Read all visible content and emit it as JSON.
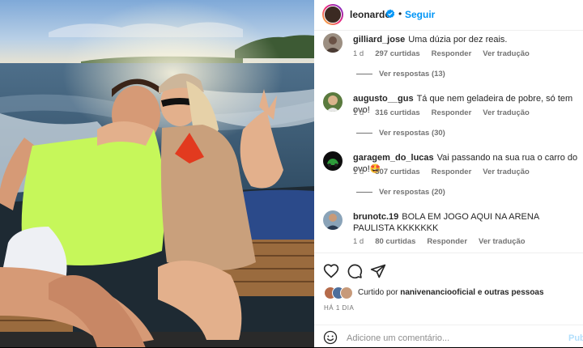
{
  "header": {
    "username": "leonardo",
    "follow_label": "Seguir",
    "dot": "•"
  },
  "comments": [
    {
      "username": "gilliard_jose",
      "text": "Uma dúzia por dez reais.",
      "time": "1 d",
      "likes": "297 curtidas",
      "reply_label": "Responder",
      "translate_label": "Ver tradução",
      "replies": "Ver respostas (13)"
    },
    {
      "username": "augusto__gus",
      "text": "Tá que nem geladeira de pobre, só tem ovo!",
      "time": "1 d",
      "likes": "316 curtidas",
      "reply_label": "Responder",
      "translate_label": "Ver tradução",
      "replies": "Ver respostas (30)"
    },
    {
      "username": "garagem_do_lucas",
      "text": "Vai passando na sua rua o carro do ovo!🤩",
      "time": "1 d",
      "likes": "307 curtidas",
      "reply_label": "Responder",
      "translate_label": "Ver tradução",
      "replies": "Ver respostas (20)"
    },
    {
      "username": "brunotc.19",
      "text": "BOLA EM JOGO AQUI NA ARENA PAULISTA KKKKKKK",
      "time": "1 d",
      "likes": "80 curtidas",
      "reply_label": "Responder",
      "translate_label": "Ver tradução"
    }
  ],
  "likes_line": {
    "prefix": "Curtido por",
    "user": "nanivenanciooficial",
    "suffix": "e outras pessoas"
  },
  "post_time": "HÁ 1 DIA",
  "add_comment": {
    "placeholder": "Adicione um comentário...",
    "publish_label": "Publicar"
  },
  "icons": {
    "like": "heart-icon",
    "comment": "comment-icon",
    "share": "share-icon",
    "emoji": "emoji-icon",
    "verified": "verified-badge-icon"
  },
  "colors": {
    "accent": "#0095f6",
    "publish_disabled": "#b2dffc",
    "muted": "#737373",
    "text": "#262626"
  }
}
